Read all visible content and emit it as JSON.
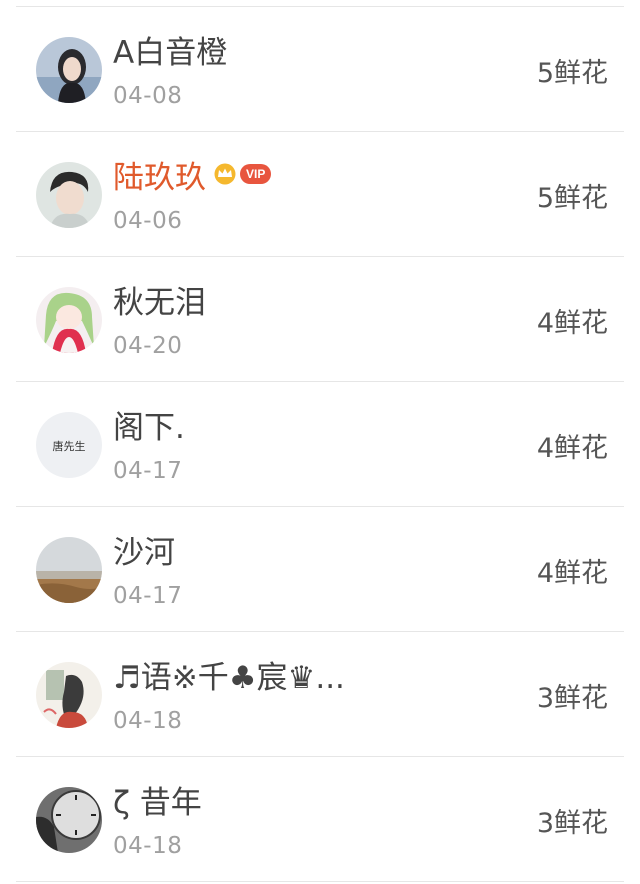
{
  "items": [
    {
      "name": "A白音橙",
      "date": "04-08",
      "flowers": "5鲜花",
      "vip": false
    },
    {
      "name": "陆玖玖",
      "date": "04-06",
      "flowers": "5鲜花",
      "vip": true,
      "vip_label": "VIP"
    },
    {
      "name": "秋无泪",
      "date": "04-20",
      "flowers": "4鲜花",
      "vip": false
    },
    {
      "name": "阁下.",
      "date": "04-17",
      "flowers": "4鲜花",
      "vip": false,
      "avatar_text": "唐先生"
    },
    {
      "name": "沙河",
      "date": "04-17",
      "flowers": "4鲜花",
      "vip": false
    },
    {
      "name": "♬语※千♣宸♛...",
      "date": "04-18",
      "flowers": "3鲜花",
      "vip": false
    },
    {
      "name": "ζ 昔年",
      "date": "04-18",
      "flowers": "3鲜花",
      "vip": false
    }
  ],
  "colors": {
    "vip_name": "#e05a2c",
    "vip_badge": "#e8553e",
    "date": "#a0a0a0",
    "divider": "#e6e6e6"
  },
  "icons": [
    "avatar",
    "crown-icon"
  ]
}
